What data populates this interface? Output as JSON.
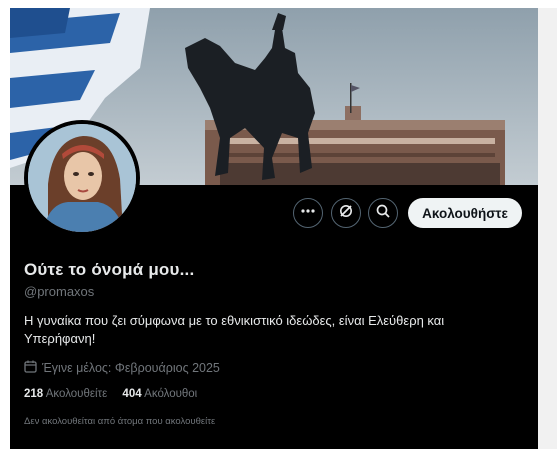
{
  "profile": {
    "display_name": "Ούτε το όνομά μου...",
    "handle": "@promaxos",
    "bio": "Η γυναίκα που ζει σύμφωνα με το εθνικιστικό ιδεώδες, είναι Ελεύθερη και Υπερήφανη!",
    "joined": "Έγινε μέλος: Φεβρουάριος 2025",
    "following_count": "218",
    "following_label": "Ακολουθείτε",
    "followers_count": "404",
    "followers_label": "Ακόλουθοι",
    "followed_by_note": "Δεν ακολουθείται από άτομα που ακολουθείτε"
  },
  "actions": {
    "more_icon": "more-icon",
    "grok_icon": "grok-icon",
    "search_icon": "search-icon",
    "follow_label": "Ακολουθήστε"
  },
  "colors": {
    "background": "#000000",
    "primary_text": "#e7e9ea",
    "secondary_text": "#71767b",
    "follow_button_bg": "#eff3f4"
  }
}
